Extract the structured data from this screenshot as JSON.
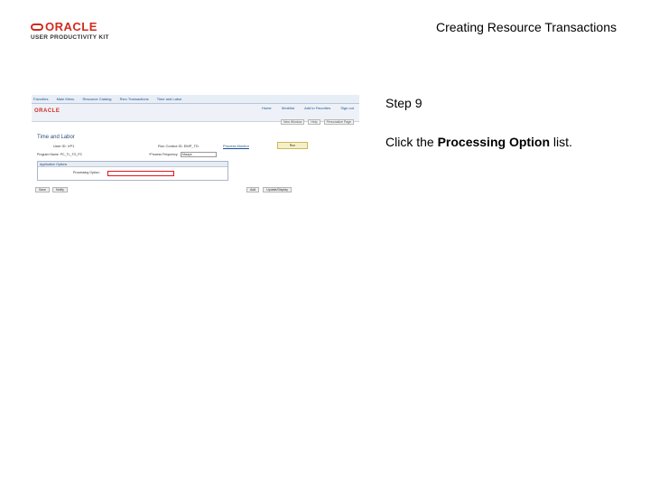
{
  "header": {
    "logo_word": "ORACLE",
    "logo_sub": "USER PRODUCTIVITY KIT",
    "title": "Creating Resource Transactions"
  },
  "screenshot": {
    "crumbs": [
      "Favorites",
      "Main Menu",
      "Resource Catalog",
      "Rsrc Transactions",
      "Time and Labor"
    ],
    "brand": "ORACLE",
    "nav_links": [
      "Home",
      "Worklist",
      "Add to Favorites",
      "Sign out"
    ],
    "util_links": [
      "New Window",
      "Help",
      "Personalize Page"
    ],
    "heading": "Time and Labor",
    "user_id_label": "User ID:",
    "user_id_value": "VP1",
    "run_control_label": "Run Control ID:",
    "run_control_value": "EMP_TD",
    "process_monitor": "Process Monitor",
    "run_button": "Run",
    "process_name_label": "Program Name:",
    "process_name_value": "PC_TL_TO_PC",
    "recurrence_label": "*Process Frequency:",
    "recurrence_value": "Always",
    "panel_title": "Application Options",
    "processing_option_label": "Processing Option:",
    "bottom_left": [
      "Save",
      "Notify"
    ],
    "bottom_right": [
      "Add",
      "Update/Display"
    ]
  },
  "step": {
    "title": "Step 9",
    "instruction_prefix": "Click the ",
    "instruction_target": "Processing Option",
    "instruction_suffix": " list."
  },
  "colors": {
    "oracle_red": "#d22b1f",
    "highlight": "#e0151c"
  }
}
